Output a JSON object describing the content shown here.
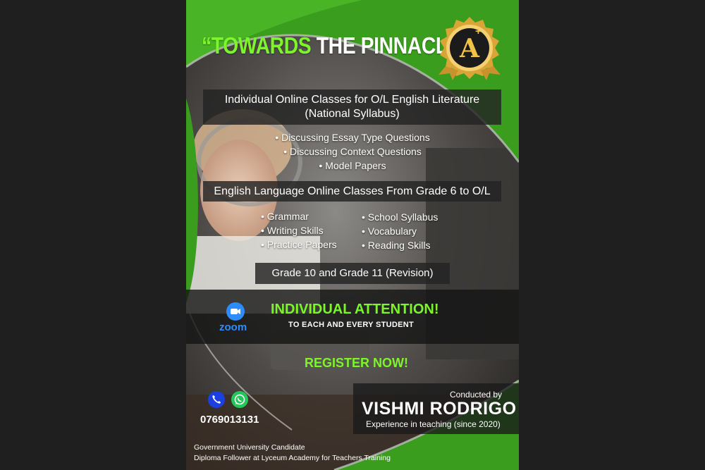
{
  "headline": {
    "part1": "“TOWARDS",
    "part2": "THE PINNACLE”"
  },
  "badge": {
    "letter": "A",
    "plus": "+",
    "icon": "grade-seal-icon"
  },
  "section1": {
    "title_line1": "Individual Online Classes for O/L English Literature",
    "title_line2": "(National Syllabus)",
    "bullets": [
      "• Discussing Essay Type Questions",
      "• Discussing Context Questions",
      "• Model Papers"
    ]
  },
  "section2": {
    "title": "English Language Online Classes From Grade 6 to O/L",
    "left_bullets": [
      "• Grammar",
      "• Writing Skills",
      "• Practice Papers"
    ],
    "right_bullets": [
      "• School Syllabus",
      "• Vocabulary",
      "• Reading Skills"
    ]
  },
  "revision": "Grade 10 and Grade 11 (Revision)",
  "zoom": {
    "label": "zoom",
    "icon": "zoom-camera-icon"
  },
  "attention": {
    "title": "INDIVIDUAL ATTENTION!",
    "subtitle": "TO EACH AND EVERY STUDENT"
  },
  "register": "REGISTER NOW!",
  "teacher": {
    "conducted_by": "Conducted by",
    "name": "VISHMI RODRIGO",
    "experience": "Experience in teaching (since 2020)"
  },
  "contact": {
    "phone": "0769013131",
    "phone_icon": "phone-icon",
    "whatsapp_icon": "whatsapp-icon"
  },
  "footer": {
    "line1": "Government University Candidate",
    "line2": "Diploma Follower at Lyceum Academy for Teachers Training"
  },
  "colors": {
    "green": "#3a9d1d",
    "accent_green": "#7cf52b",
    "gold": "#f3c247",
    "zoom_blue": "#2d8cff"
  }
}
